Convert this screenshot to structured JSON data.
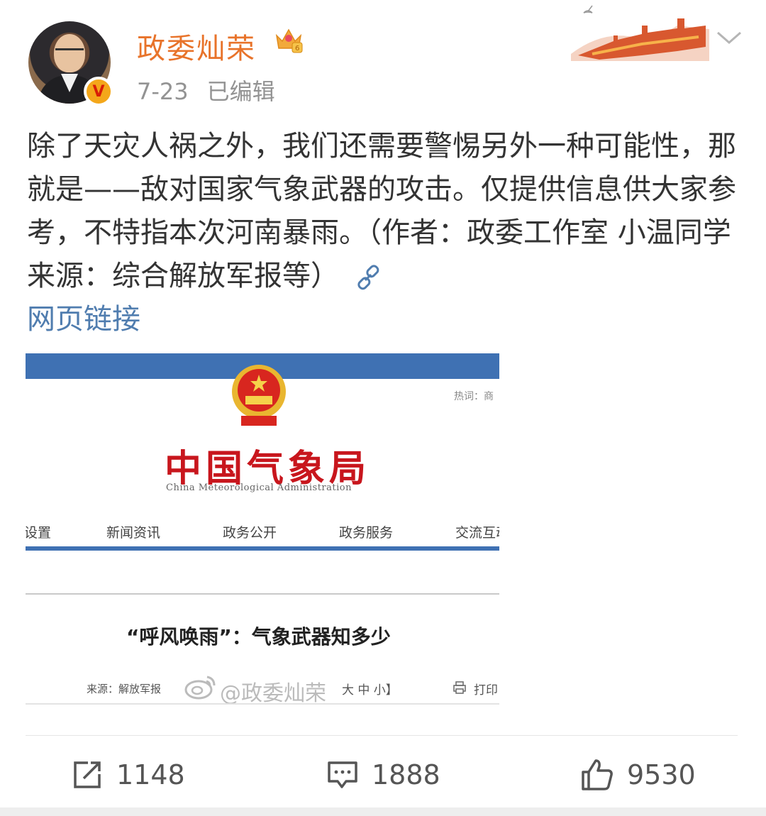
{
  "post": {
    "author": "政委灿荣",
    "verified_badge": "V",
    "date": "7-23",
    "edited": "已编辑",
    "text": "除了天灾人祸之外，我们还需要警惕另外一种可能性，那就是——敌对国家气象武器的攻击。仅提供信息供大家参考，不特指本次河南暴雨。（作者：政委工作室 小温同学 来源：综合解放军报等）",
    "link_label": "网页链接"
  },
  "card": {
    "hot_label": "热词：商",
    "site_title": "中国气象局",
    "site_title_en": "China Meteorological Administration",
    "nav": [
      "设置",
      "新闻资讯",
      "政务公开",
      "政务服务",
      "交流互动"
    ],
    "article_title": "“呼风唤雨”：气象武器知多少",
    "source": "来源：解放军报",
    "watermark": "@政委灿荣",
    "font_size_controls": "大 中 小】",
    "print_label": "打印"
  },
  "actions": {
    "repost_count": "1148",
    "comment_count": "1888",
    "like_count": "9530"
  },
  "icons": [
    "crown-icon",
    "chevron-down-icon",
    "link-icon",
    "national-emblem-icon",
    "weibo-logo-icon",
    "print-icon",
    "repost-icon",
    "comment-icon",
    "like-icon"
  ],
  "colors": {
    "username": "#e8732a",
    "link": "#507daf",
    "card_bar": "#3f71b3",
    "cma_red": "#c8161d",
    "badge": "#f4a71a"
  }
}
